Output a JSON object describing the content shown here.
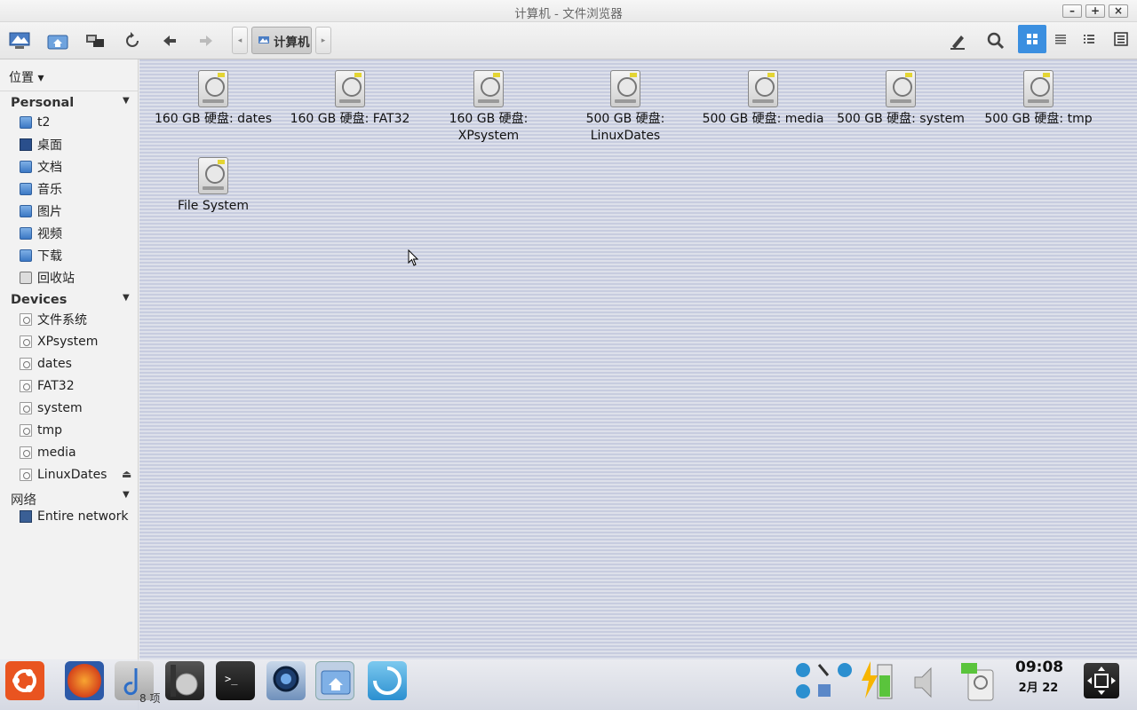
{
  "window": {
    "title": "计算机 - 文件浏览器",
    "buttons": [
      "–",
      "+",
      "×"
    ]
  },
  "toolbar": {
    "breadcrumb_label": "计算机",
    "crumb_left": "◂",
    "crumb_right": "▸"
  },
  "sidebar": {
    "places_label": "位置 ▾",
    "sections": {
      "personal": "Personal",
      "devices": "Devices",
      "network": "网络"
    },
    "personal_items": [
      "t2",
      "桌面",
      "文档",
      "音乐",
      "图片",
      "视频",
      "下载",
      "回收站"
    ],
    "device_items": [
      "文件系统",
      "XPsystem",
      "dates",
      "FAT32",
      "system",
      "tmp",
      "media",
      "LinuxDates"
    ],
    "network_items": [
      "Entire network"
    ]
  },
  "files": [
    {
      "line1": "160 GB 硬盘: dates",
      "line2": ""
    },
    {
      "line1": "160 GB 硬盘: FAT32",
      "line2": ""
    },
    {
      "line1": "160 GB 硬盘:",
      "line2": "XPsystem"
    },
    {
      "line1": "500 GB 硬盘:",
      "line2": "LinuxDates"
    },
    {
      "line1": "500 GB 硬盘: media",
      "line2": ""
    },
    {
      "line1": "500 GB 硬盘: system",
      "line2": ""
    },
    {
      "line1": "500 GB 硬盘: tmp",
      "line2": ""
    },
    {
      "line1": "File System",
      "line2": ""
    }
  ],
  "status": {
    "items_count": "8 项"
  },
  "clock": {
    "time": "09:08",
    "date": "2月 22"
  },
  "colors": {
    "accent": "#3b8fe0",
    "ubuntu": "#e95420"
  }
}
